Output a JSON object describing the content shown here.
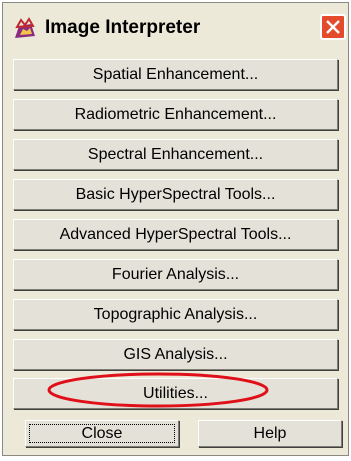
{
  "window": {
    "title": "Image Interpreter"
  },
  "icons": {
    "app": "image-interpreter-app-icon",
    "close": "close-icon"
  },
  "buttons": [
    {
      "label": "Spatial Enhancement..."
    },
    {
      "label": "Radiometric Enhancement..."
    },
    {
      "label": "Spectral Enhancement..."
    },
    {
      "label": "Basic HyperSpectral Tools..."
    },
    {
      "label": "Advanced HyperSpectral Tools..."
    },
    {
      "label": "Fourier Analysis..."
    },
    {
      "label": "Topographic Analysis..."
    },
    {
      "label": "GIS Analysis..."
    },
    {
      "label": "Utilities..."
    }
  ],
  "footer": {
    "close_label": "Close",
    "help_label": "Help"
  },
  "colors": {
    "dialog_bg": "#ece9d8",
    "annotation": "#e0101a",
    "close_button": "#e44b2c"
  }
}
